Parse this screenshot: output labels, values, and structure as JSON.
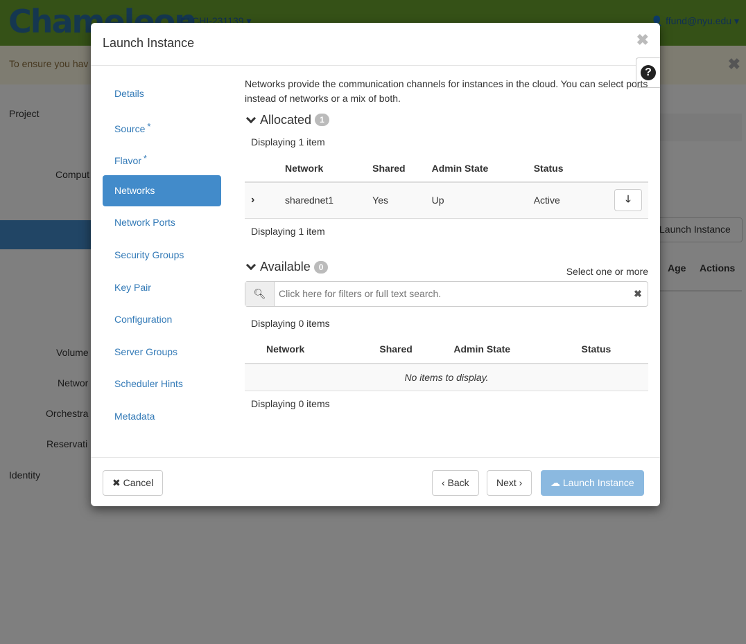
{
  "background": {
    "logo": "Chameleon",
    "project": "CHI-231139",
    "user": "ffund@nyu.edu",
    "alert": "To ensure you hav",
    "sidebar": [
      "Project",
      "Comput",
      "Volume",
      "Networ",
      "Orchestra",
      "Reservati",
      "Identity"
    ],
    "launch_button": "Launch Instance",
    "headers": [
      "Age",
      "Actions"
    ]
  },
  "modal": {
    "title": "Launch Instance",
    "nav": [
      {
        "label": "Details"
      },
      {
        "label": "Source",
        "required": "*"
      },
      {
        "label": "Flavor",
        "required": "*"
      },
      {
        "label": "Networks"
      },
      {
        "label": "Network Ports"
      },
      {
        "label": "Security Groups"
      },
      {
        "label": "Key Pair"
      },
      {
        "label": "Configuration"
      },
      {
        "label": "Server Groups"
      },
      {
        "label": "Scheduler Hints"
      },
      {
        "label": "Metadata"
      }
    ],
    "description": "Networks provide the communication channels for instances in the cloud. You can select ports instead of networks or a mix of both.",
    "allocated": {
      "title": "Allocated",
      "count": "1",
      "displaying": "Displaying 1 item",
      "columns": [
        "Network",
        "Shared",
        "Admin State",
        "Status"
      ],
      "rows": [
        {
          "network": "sharednet1",
          "shared": "Yes",
          "admin_state": "Up",
          "status": "Active"
        }
      ]
    },
    "available": {
      "title": "Available",
      "count": "0",
      "hint": "Select one or more",
      "search_placeholder": "Click here for filters or full text search.",
      "displaying": "Displaying 0 items",
      "columns": [
        "Network",
        "Shared",
        "Admin State",
        "Status"
      ],
      "empty": "No items to display."
    },
    "footer": {
      "cancel": "Cancel",
      "back": "Back",
      "next": "Next",
      "launch": "Launch Instance"
    }
  }
}
